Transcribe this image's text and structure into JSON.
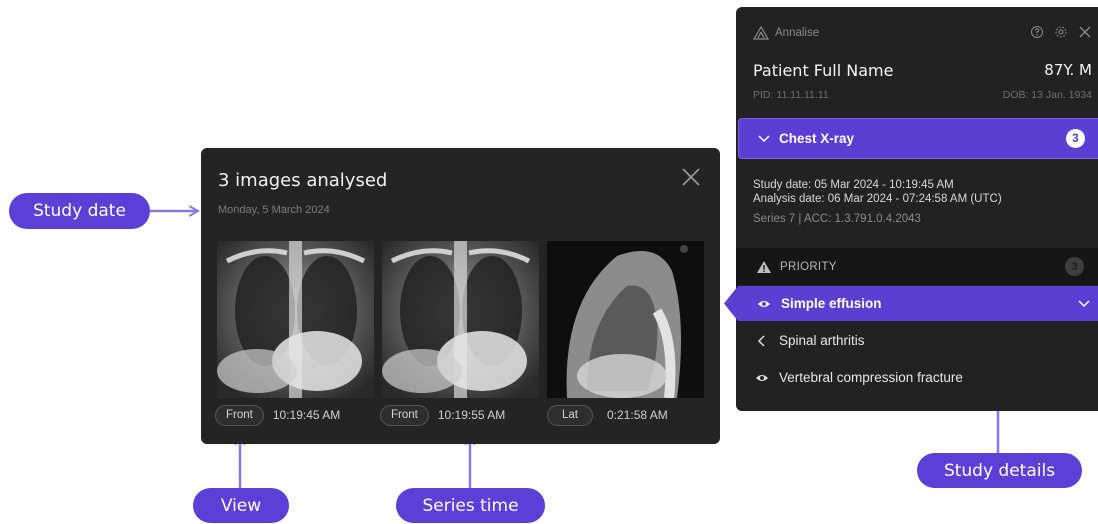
{
  "callouts": {
    "study_date": "Study date",
    "view": "View",
    "series_time": "Series time",
    "study_details": "Study details"
  },
  "popup": {
    "title": "3 images analysed",
    "date": "Monday, 5 March 2024",
    "images": [
      {
        "view": "Front",
        "time": "10:19:45 AM"
      },
      {
        "view": "Front",
        "time": "10:19:55 AM"
      },
      {
        "view": "Lat",
        "time": "0:21:58 AM"
      }
    ]
  },
  "panel": {
    "brand": "Annalise",
    "patient_name": "Patient Full Name",
    "age_sex": "87Y. M",
    "pid": "PID: 11.11.11.11",
    "dob": "DOB: 13 Jan. 1934",
    "study": {
      "name": "Chest X-ray",
      "count": "3",
      "study_date": "Study date: 05 Mar 2024 - 10:19:45 AM",
      "analysis_date": "Analysis date: 06 Mar 2024 - 07:24:58 AM (UTC)",
      "series_acc": "Series 7  |  ACC: 1.3.791.0.4.2043"
    },
    "priority": {
      "label": "PRIORITY",
      "count": "3"
    },
    "active_finding": "Simple effusion",
    "findings": [
      "Spinal arthritis",
      "Vertebral compression fracture"
    ]
  },
  "colors": {
    "accent": "#5a3fd2",
    "callout": "#5b3fd6",
    "arrow": "#8a76e6",
    "panel_bg": "#222222",
    "popup_bg": "#242424"
  }
}
